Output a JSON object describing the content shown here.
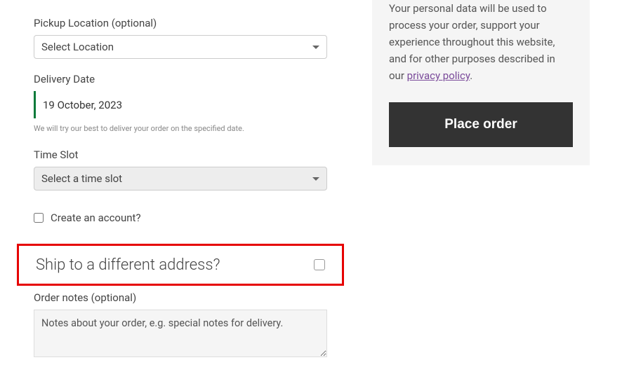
{
  "pickup": {
    "label": "Pickup Location (optional)",
    "selected": "Select Location"
  },
  "delivery": {
    "label": "Delivery Date",
    "value": "19 October, 2023",
    "hint": "We will try our best to deliver your order on the specified date."
  },
  "timeslot": {
    "label": "Time Slot",
    "selected": "Select a time slot"
  },
  "createAccount": {
    "label": "Create an account?"
  },
  "shipDifferent": {
    "title": "Ship to a different address?"
  },
  "orderNotes": {
    "label": "Order notes (optional)",
    "placeholder": "Notes about your order, e.g. special notes for delivery."
  },
  "privacy": {
    "text_before": "Your personal data will be used to process your order, support your experience throughout this website, and for other purposes described in our ",
    "link": "privacy policy",
    "text_after": "."
  },
  "placeOrder": {
    "label": "Place order"
  }
}
